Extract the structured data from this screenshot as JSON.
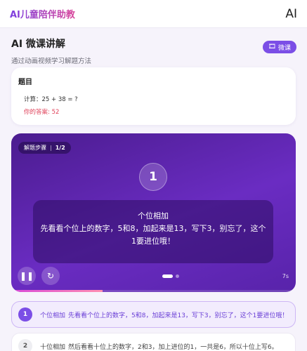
{
  "header": {
    "brand": "AI儿童陪伴助教",
    "right_glyph": "AI"
  },
  "page": {
    "title": "AI 微课讲解",
    "subtitle": "通过动画视频学习解题方法",
    "microclass_button": "微课",
    "microclass_icon": "film-icon"
  },
  "question": {
    "title": "题目",
    "calc": "计算：25 + 38 = ?",
    "your_answer": "你的答案: 52"
  },
  "player": {
    "step_label": "解题步骤",
    "step_counter": "1/2",
    "current_step_number": "1",
    "caption_title": "个位相加",
    "caption_text": "先看看个位上的数字，5和8，加起来是13，写下3，别忘了，这个1要进位哦！",
    "duration": "7s",
    "progress_fraction": 0.32,
    "dots": {
      "total": 2,
      "active": 1
    }
  },
  "steps": [
    {
      "number": "1",
      "title": "个位相加",
      "text": "先看看个位上的数字，5和8，加起来是13，写下3，别忘了，这个1要进位哦！"
    },
    {
      "number": "2",
      "title": "十位相加",
      "text": "然后看看十位上的数字，2和3，加上进位的1，一共是6，所以十位上写6。"
    }
  ],
  "colors": {
    "accent": "#7b4ee6",
    "brand_from": "#7b3fe0",
    "brand_to": "#d9459a",
    "error": "#e0435b"
  }
}
